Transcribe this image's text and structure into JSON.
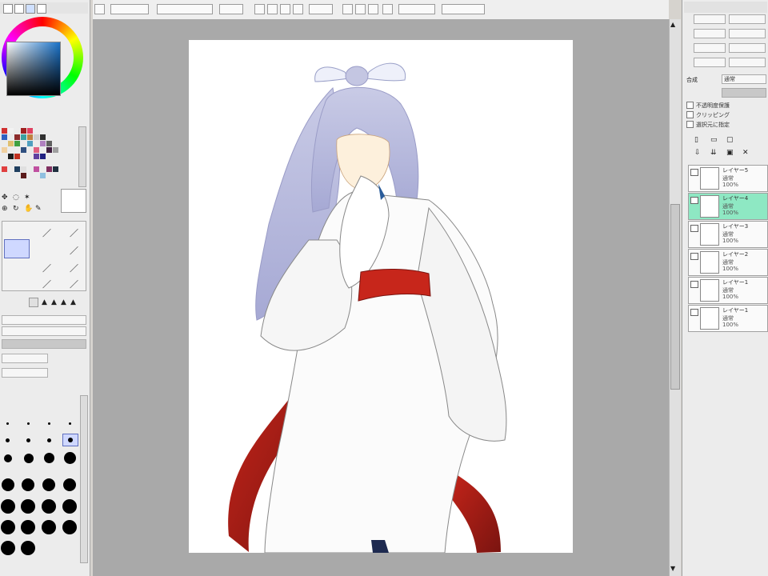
{
  "layers": [
    {
      "name": "レイヤー5",
      "mode": "通常",
      "opacity": "100%",
      "selected": false
    },
    {
      "name": "レイヤー4",
      "mode": "通常",
      "opacity": "100%",
      "selected": true
    },
    {
      "name": "レイヤー3",
      "mode": "通常",
      "opacity": "100%",
      "selected": false
    },
    {
      "name": "レイヤー2",
      "mode": "通常",
      "opacity": "100%",
      "selected": false
    },
    {
      "name": "レイヤー1",
      "mode": "通常",
      "opacity": "100%",
      "selected": false
    },
    {
      "name": "レイヤー1",
      "mode": "通常",
      "opacity": "100%",
      "selected": false
    }
  ],
  "right_panel": {
    "mode_label": "合成",
    "mode_value": "通常",
    "checkbox_labels": [
      "不透明度保護",
      "クリッピング",
      "選択元に指定"
    ]
  },
  "colors": {
    "accent_selected_layer": "#8ee8c3",
    "workspace": "#a9a9a9",
    "paper": "#ffffff"
  }
}
